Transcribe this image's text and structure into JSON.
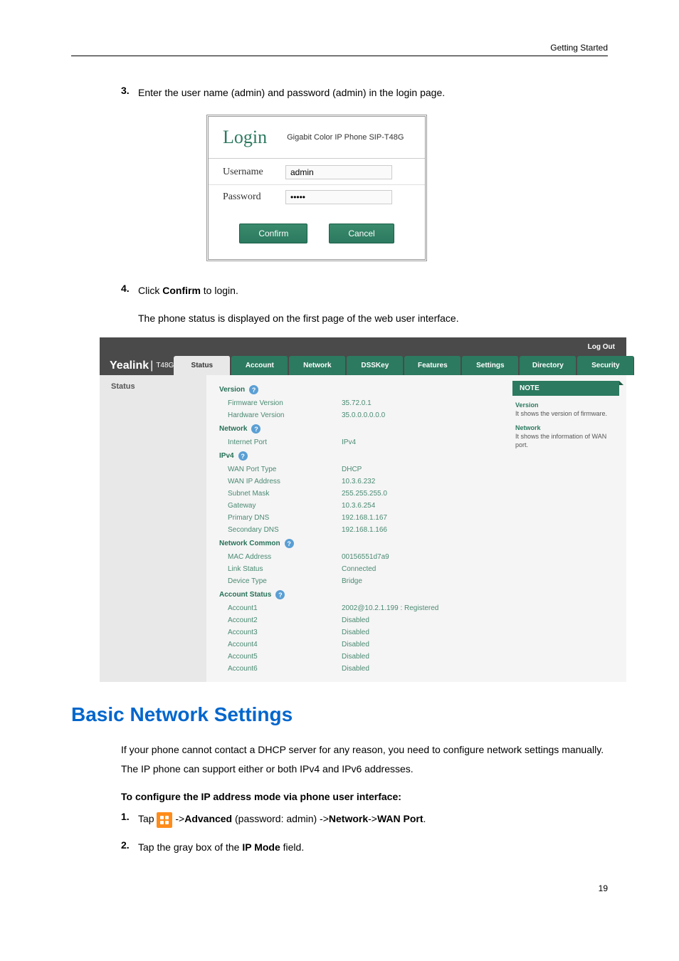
{
  "header": {
    "section": "Getting Started"
  },
  "step3": {
    "num": "3.",
    "text": "Enter the user name (admin) and password (admin) in the login page."
  },
  "login": {
    "title": "Login",
    "subtitle": "Gigabit Color IP Phone SIP-T48G",
    "username_label": "Username",
    "username_value": "admin",
    "password_label": "Password",
    "password_value": "•••••",
    "confirm": "Confirm",
    "cancel": "Cancel"
  },
  "step4": {
    "num": "4.",
    "text_pre": "Click ",
    "bold": "Confirm",
    "text_post": " to login."
  },
  "step4_note": "The phone status is displayed on the first page of the web user interface.",
  "yealink": {
    "logo": "Yealink",
    "logo_model": "T48G",
    "logout": "Log Out",
    "tabs": [
      "Status",
      "Account",
      "Network",
      "DSSKey",
      "Features",
      "Settings",
      "Directory",
      "Security"
    ],
    "sidebar": [
      "Status"
    ],
    "note_header": "NOTE",
    "note_items": [
      {
        "title": "Version",
        "text": "It shows the version of firmware."
      },
      {
        "title": "Network",
        "text": "It shows the information of WAN port."
      }
    ],
    "sections": [
      {
        "header": "Version",
        "rows": [
          {
            "label": "Firmware Version",
            "value": "35.72.0.1"
          },
          {
            "label": "Hardware Version",
            "value": "35.0.0.0.0.0.0"
          }
        ]
      },
      {
        "header": "Network",
        "rows": [
          {
            "label": "Internet Port",
            "value": "IPv4"
          }
        ]
      },
      {
        "header": "IPv4",
        "rows": [
          {
            "label": "WAN Port Type",
            "value": "DHCP"
          },
          {
            "label": "WAN IP Address",
            "value": "10.3.6.232"
          },
          {
            "label": "Subnet Mask",
            "value": "255.255.255.0"
          },
          {
            "label": "Gateway",
            "value": "10.3.6.254"
          },
          {
            "label": "Primary DNS",
            "value": "192.168.1.167"
          },
          {
            "label": "Secondary DNS",
            "value": "192.168.1.166"
          }
        ]
      },
      {
        "header": "Network Common",
        "rows": [
          {
            "label": "MAC Address",
            "value": "00156551d7a9"
          },
          {
            "label": "Link Status",
            "value": "Connected"
          },
          {
            "label": "Device Type",
            "value": "Bridge"
          }
        ]
      },
      {
        "header": "Account Status",
        "rows": [
          {
            "label": "Account1",
            "value": "2002@10.2.1.199 : Registered"
          },
          {
            "label": "Account2",
            "value": "Disabled"
          },
          {
            "label": "Account3",
            "value": "Disabled"
          },
          {
            "label": "Account4",
            "value": "Disabled"
          },
          {
            "label": "Account5",
            "value": "Disabled"
          },
          {
            "label": "Account6",
            "value": "Disabled"
          }
        ]
      }
    ]
  },
  "heading": "Basic Network Settings",
  "para1": "If your phone cannot contact a DHCP server for any reason, you need to configure network settings manually. The IP phone can support either or both IPv4 and IPv6 addresses.",
  "configHeader": "To configure the IP address mode via phone user interface:",
  "step1b": {
    "num": "1.",
    "pre": "Tap ",
    "mid1": " ->",
    "b1": "Advanced",
    "mid2": " (password: admin) ->",
    "b2": "Network",
    "mid3": "->",
    "b3": "WAN Port",
    "post": "."
  },
  "step2b": {
    "num": "2.",
    "pre": "Tap the gray box of the ",
    "b1": "IP Mode",
    "post": " field."
  },
  "pageNum": "19"
}
